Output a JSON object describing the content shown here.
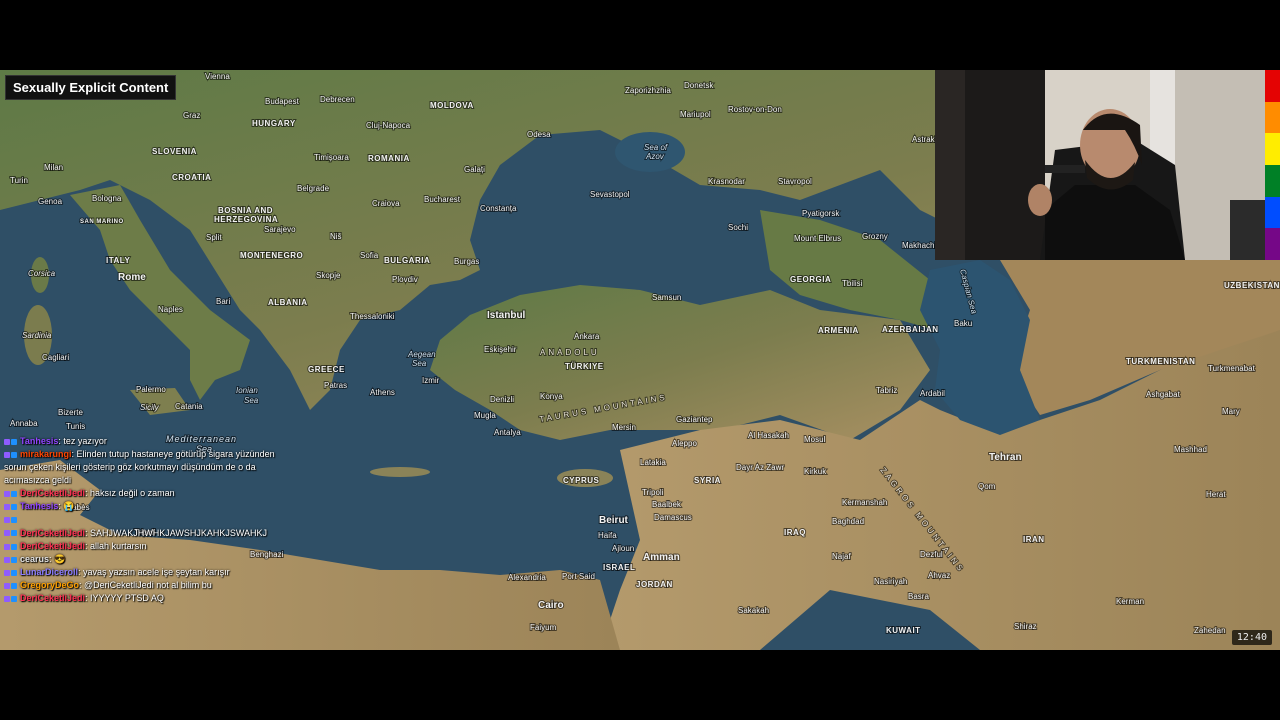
{
  "overlay": {
    "content_warning": "Sexually Explicit Content",
    "clock": "12:40",
    "rainbow_colors": [
      "#e40303",
      "#ff8c00",
      "#ffed00",
      "#008026",
      "#004dff",
      "#750787"
    ]
  },
  "map": {
    "countries": [
      "HUNGARY",
      "ROMANIA",
      "SLOVENIA",
      "CROATIA",
      "BOSNIA AND HERZEGOVINA",
      "MONTENEGRO",
      "ITALY",
      "ALBANIA",
      "BULGARIA",
      "GREECE",
      "MOLDOVA",
      "GEORGIA",
      "ARMENIA",
      "AZERBAIJAN",
      "UZBEKISTAN",
      "TURKMENISTAN",
      "TÜRKIYE",
      "SYRIA",
      "IRAQ",
      "IRAN",
      "JORDAN",
      "ISRAEL",
      "KUWAIT",
      "CYPRUS",
      "SAN MARINO"
    ],
    "cities": [
      "Vienna",
      "Budapest",
      "Debrecen",
      "Graz",
      "Cluj-Napoca",
      "Zaporizhzhia",
      "Donetsk",
      "Rostov-on-Don",
      "Mariupol",
      "Odesa",
      "Milan",
      "Turin",
      "Genoa",
      "Bologna",
      "Timișoara",
      "Belgrade",
      "Craiova",
      "Bucharest",
      "Galați",
      "Constanța",
      "Sevastopol",
      "Krasnodar",
      "Stavropol",
      "Pyatigorsk",
      "Sochi",
      "Mount Elbrus",
      "Grozny",
      "Makhachkala",
      "Astrakhan",
      "Split",
      "Sarajevo",
      "Niš",
      "Sofia",
      "Skopje",
      "Plovdiv",
      "Burgas",
      "Rome",
      "Naples",
      "Bari",
      "Thessaloniki",
      "Istanbul",
      "Samsun",
      "Tbilisi",
      "Baku",
      "Ankara",
      "Eskişehir",
      "Izmir",
      "Athens",
      "Patras",
      "Palermo",
      "Catania",
      "Cagliari",
      "Denizli",
      "Konya",
      "Mugla",
      "Antalya",
      "Mersin",
      "Gaziantep",
      "Tabriz",
      "Ardabil",
      "Aleppo",
      "Al Hasakah",
      "Mosul",
      "Kirkuk",
      "Dayr Az Zawr",
      "Latakia",
      "Tripoli",
      "Baalbek",
      "Damascus",
      "Beirut",
      "Haifa",
      "Ajloun",
      "Amman",
      "Tehran",
      "Qom",
      "Mashhad",
      "Ashgabat",
      "Turkmenabat",
      "Mary",
      "Herat",
      "Kermanshah",
      "Baghdad",
      "Najaf",
      "Dezful",
      "Ahvaz",
      "Nasiriyah",
      "Basra",
      "Kerman",
      "Shiraz",
      "Zahedan",
      "Sakakah",
      "Alexandria",
      "Port Said",
      "Cairo",
      "Faiyum",
      "Benghazi",
      "Tripoli",
      "Gabès",
      "Tunis",
      "Annaba",
      "Bizerte"
    ],
    "seas": [
      "Sea of Azov",
      "Caspian Sea",
      "Mediterranean Sea",
      "Ionian Sea",
      "Aegean Sea"
    ],
    "regions": [
      "ANADOLU",
      "TAURUS MOUNTAINS",
      "ZAGROS MOUNTAINS",
      "Corsica",
      "Sardinia",
      "Sicily"
    ]
  },
  "chat": [
    {
      "user": "Tanhesis",
      "user_color": "#9146ff",
      "text": "tez yazıyor"
    },
    {
      "user": "mirakarungi",
      "user_color": "#ff4500",
      "text": "Elinden tutup hastaneye götürüp sigara yüzünden sorun çeken kişileri gösterip göz korkutmayı düşündüm de o da acımasızca geldi"
    },
    {
      "user": "DeriCeketliJedi",
      "user_color": "#ff3355",
      "text": "haksız değil o zaman"
    },
    {
      "user": "Tanhesis",
      "user_color": "#9146ff",
      "text": "😭"
    },
    {
      "user": "",
      "user_color": "#aaaaaa",
      "text": ""
    },
    {
      "user": "DeriCeketliJedi",
      "user_color": "#ff3355",
      "text": "SAHJWAKJHWHKJAWSHJKAHKJSWAHKJ"
    },
    {
      "user": "DeriCeketliJedi",
      "user_color": "#ff3355",
      "text": "allah kurtarsın"
    },
    {
      "user": "cearus",
      "user_color": "#e0e0e0",
      "text": "😎"
    },
    {
      "user": "LunarDiceroll",
      "user_color": "#8a7cff",
      "text": "yavaş yazsın acele işe şeytan karışır"
    },
    {
      "user": "GregoryDeGo",
      "user_color": "#ffa000",
      "text": "@DeriCeketliJedi not al bilim bu"
    },
    {
      "user": "DeriCeketliJedi",
      "user_color": "#ff3355",
      "text": "IYYYYY PTSD AQ"
    }
  ]
}
